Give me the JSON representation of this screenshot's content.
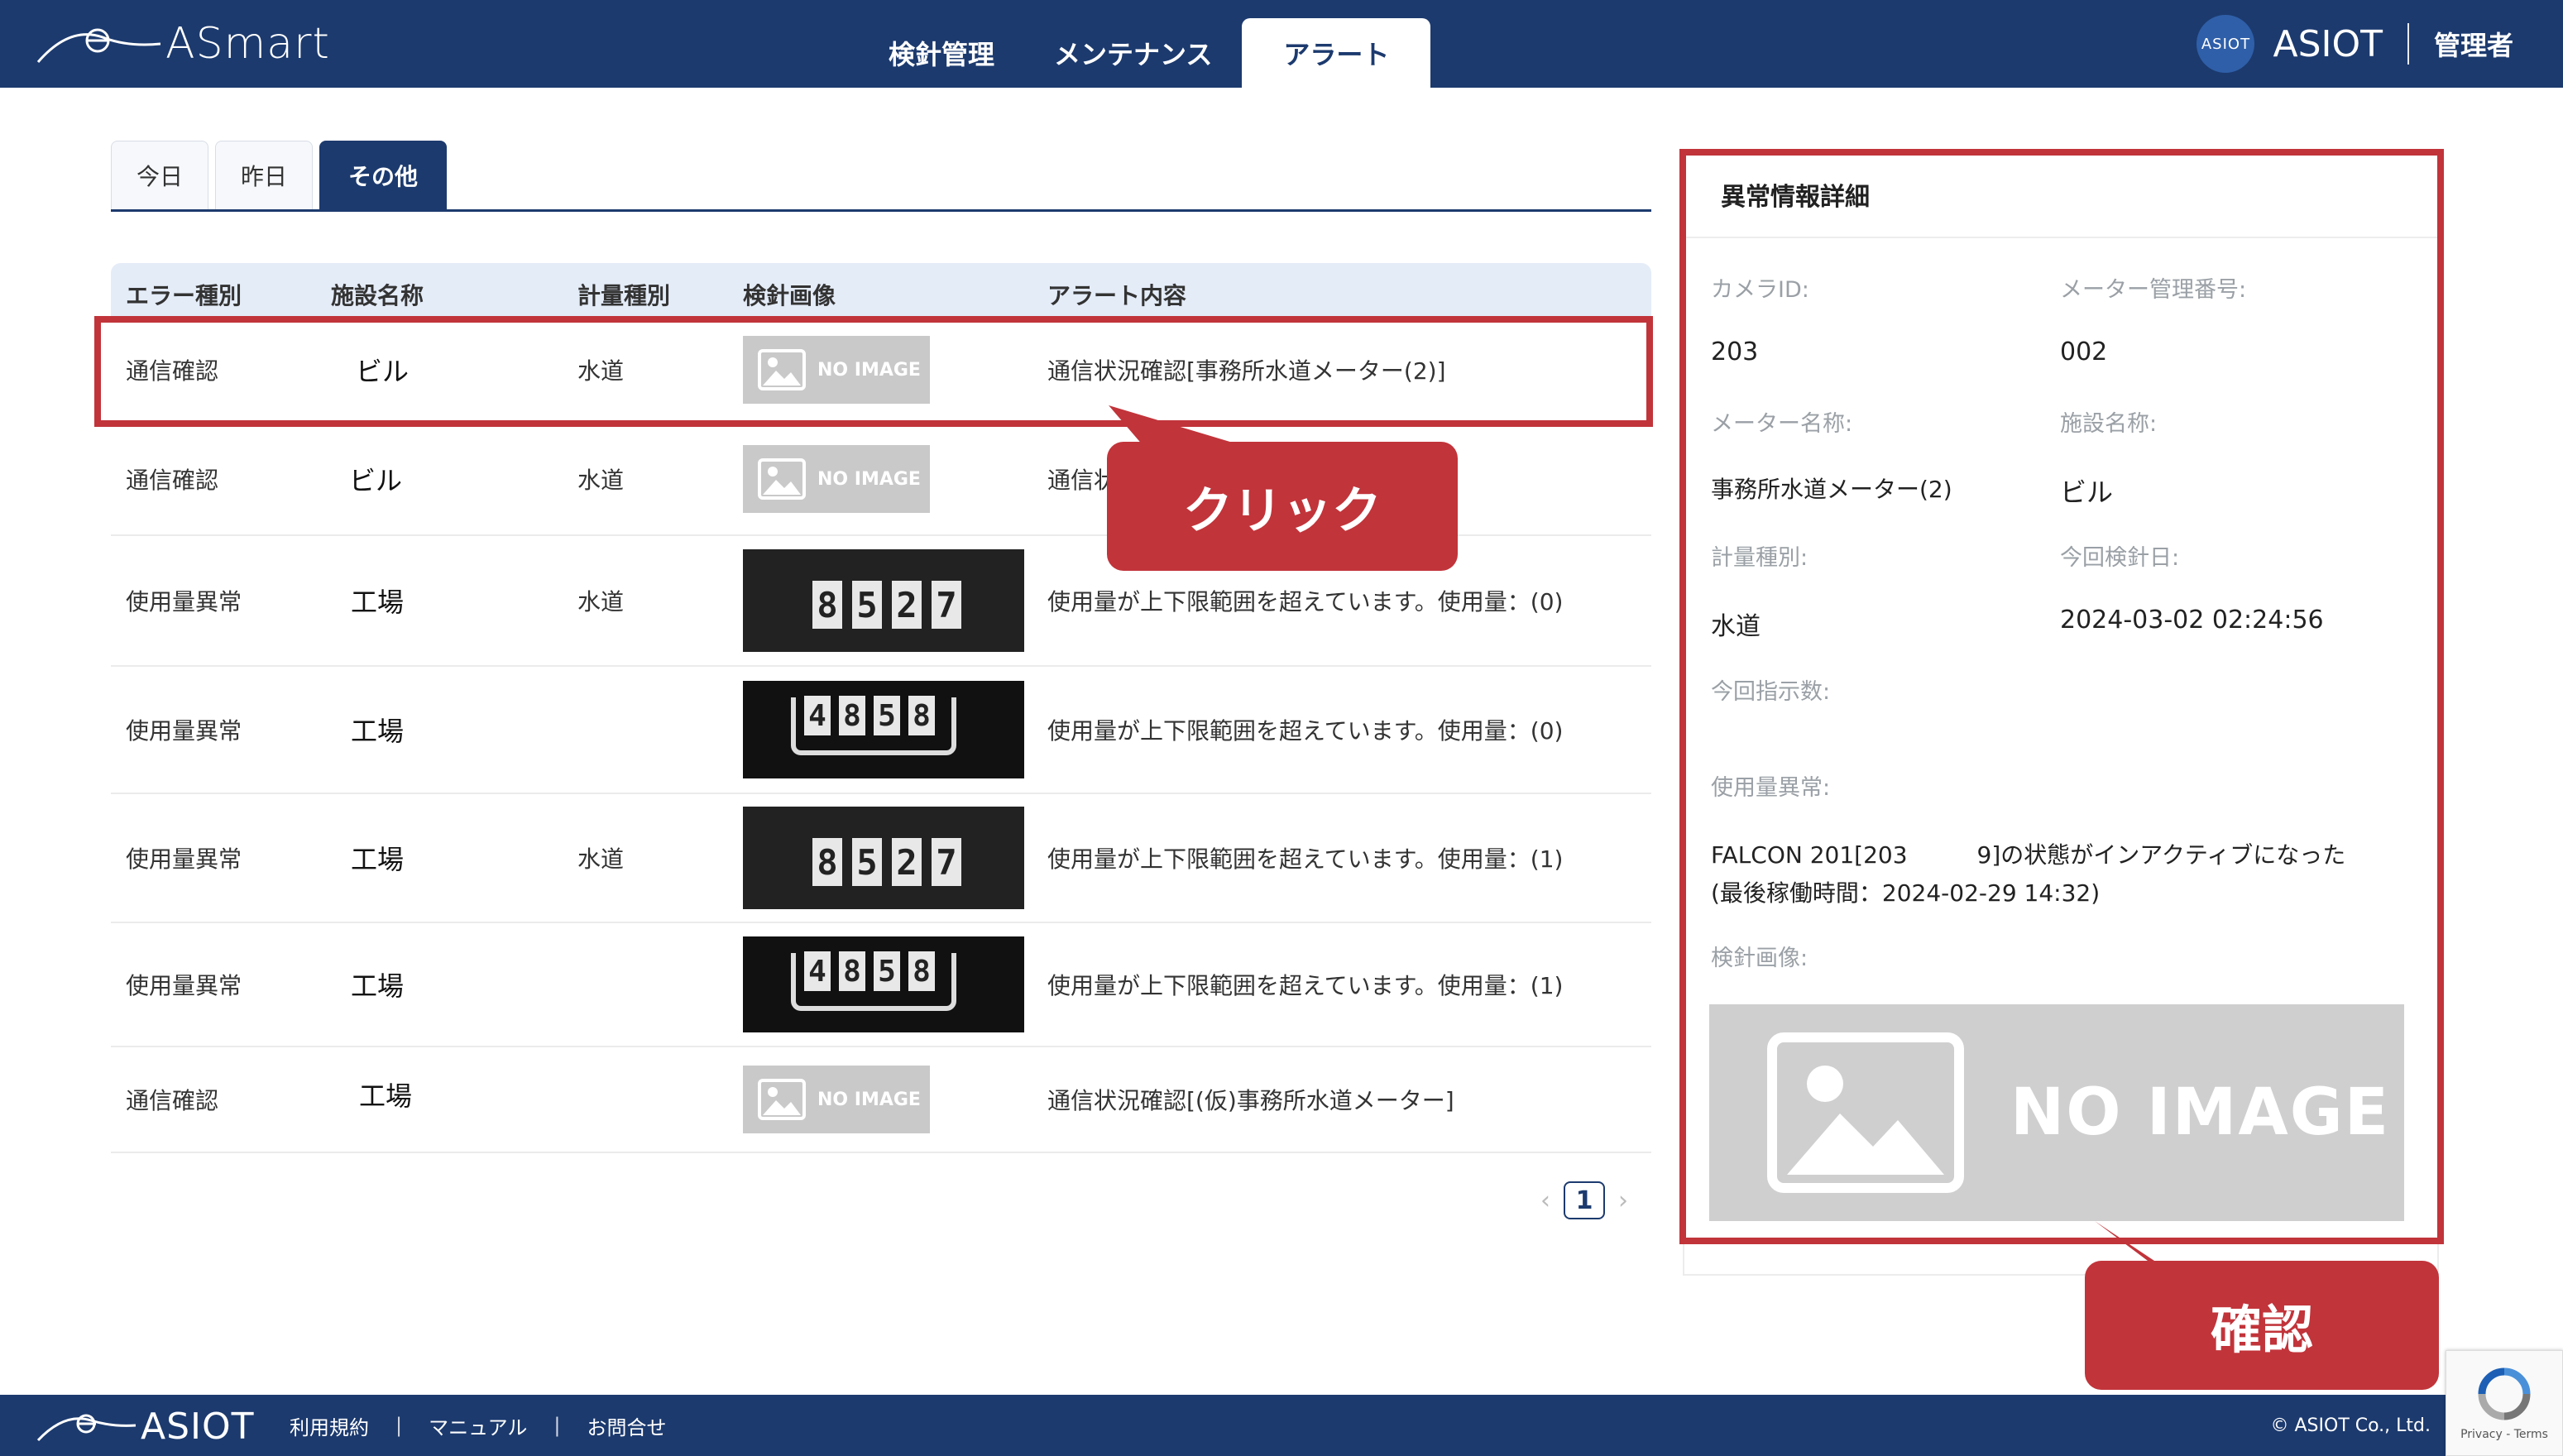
{
  "header": {
    "app_name": "ASmart",
    "nav": [
      "検針管理",
      "メンテナンス",
      "アラート"
    ],
    "active_nav": "アラート",
    "avatar_text": "ASIOT",
    "brand": "ASIOT",
    "role": "管理者"
  },
  "date_tabs": [
    "今日",
    "昨日",
    "その他"
  ],
  "active_date_tab": "その他",
  "table": {
    "columns": [
      "エラー種別",
      "施設名称",
      "計量種別",
      "検針画像",
      "アラート内容"
    ],
    "rows": [
      {
        "error_type": "通信確認",
        "facility": "ビル",
        "metering": "水道",
        "image": "no_image",
        "alert": "通信状況確認[事務所水道メーター(2)]"
      },
      {
        "error_type": "通信確認",
        "facility": "ビル",
        "metering": "水道",
        "image": "no_image",
        "alert": "通信状"
      },
      {
        "error_type": "使用量異常",
        "facility": "工場",
        "metering": "水道",
        "image": "meter_a",
        "alert": "使用量が上下限範囲を超えています。使用量：(0)"
      },
      {
        "error_type": "使用量異常",
        "facility": "工場",
        "metering": "",
        "image": "meter_b",
        "alert": "使用量が上下限範囲を超えています。使用量：(0)"
      },
      {
        "error_type": "使用量異常",
        "facility": "工場",
        "metering": "水道",
        "image": "meter_a",
        "alert": "使用量が上下限範囲を超えています。使用量：(1)"
      },
      {
        "error_type": "使用量異常",
        "facility": "工場",
        "metering": "",
        "image": "meter_b",
        "alert": "使用量が上下限範囲を超えています。使用量：(1)"
      },
      {
        "error_type": "通信確認",
        "facility": "工場",
        "metering": "",
        "image": "no_image",
        "alert": "通信状況確認[(仮)事務所水道メーター]"
      }
    ],
    "no_image_label": "NO IMAGE",
    "meter_a_digits": [
      "8",
      "5",
      "2",
      "7"
    ],
    "meter_b_digits": [
      "4",
      "8",
      "5",
      "8"
    ]
  },
  "pager": {
    "prev": "‹",
    "current": "1",
    "next": "›"
  },
  "detail": {
    "title": "異常情報詳細",
    "camera_id_label": "カメラID:",
    "camera_id": "203",
    "meter_no_label": "メーター管理番号:",
    "meter_no": "002",
    "meter_name_label": "メーター名称:",
    "meter_name": "事務所水道メーター(2)",
    "facility_label": "施設名称:",
    "facility": "ビル",
    "metering_label": "計量種別:",
    "metering": "水道",
    "reading_date_label": "今回検針日:",
    "reading_date": "2024-03-02 02:24:56",
    "indication_label": "今回指示数:",
    "usage_label": "使用量異常:",
    "usage_line1": "FALCON 201[203　　　9]の状態がインアクティブになった",
    "usage_line2": "(最後稼働時間：2024-02-29 14:32)",
    "image_label": "検針画像:",
    "no_image_label": "NO IMAGE"
  },
  "annotations": {
    "click": "クリック",
    "confirm": "確認",
    "color": "#c1343a"
  },
  "footer": {
    "logo": "ASIOT",
    "links": [
      "利用規約",
      "マニュアル",
      "お問合せ"
    ],
    "copyright": "© ASIOT Co., Ltd."
  },
  "recaptcha": "Privacy - Terms"
}
